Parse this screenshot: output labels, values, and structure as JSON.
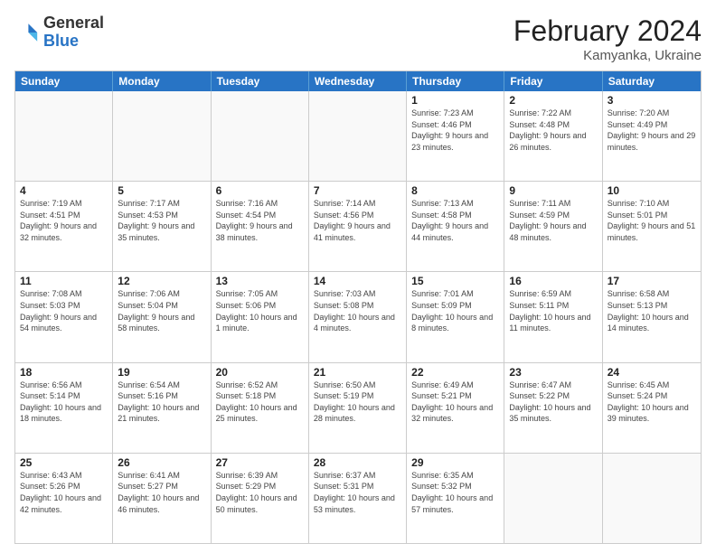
{
  "header": {
    "logo": {
      "general": "General",
      "blue": "Blue"
    },
    "title": "February 2024",
    "location": "Kamyanka, Ukraine"
  },
  "days_of_week": [
    "Sunday",
    "Monday",
    "Tuesday",
    "Wednesday",
    "Thursday",
    "Friday",
    "Saturday"
  ],
  "rows": [
    [
      {
        "day": "",
        "empty": true
      },
      {
        "day": "",
        "empty": true
      },
      {
        "day": "",
        "empty": true
      },
      {
        "day": "",
        "empty": true
      },
      {
        "day": "1",
        "sunrise": "7:23 AM",
        "sunset": "4:46 PM",
        "daylight": "9 hours and 23 minutes."
      },
      {
        "day": "2",
        "sunrise": "7:22 AM",
        "sunset": "4:48 PM",
        "daylight": "9 hours and 26 minutes."
      },
      {
        "day": "3",
        "sunrise": "7:20 AM",
        "sunset": "4:49 PM",
        "daylight": "9 hours and 29 minutes."
      }
    ],
    [
      {
        "day": "4",
        "sunrise": "7:19 AM",
        "sunset": "4:51 PM",
        "daylight": "9 hours and 32 minutes."
      },
      {
        "day": "5",
        "sunrise": "7:17 AM",
        "sunset": "4:53 PM",
        "daylight": "9 hours and 35 minutes."
      },
      {
        "day": "6",
        "sunrise": "7:16 AM",
        "sunset": "4:54 PM",
        "daylight": "9 hours and 38 minutes."
      },
      {
        "day": "7",
        "sunrise": "7:14 AM",
        "sunset": "4:56 PM",
        "daylight": "9 hours and 41 minutes."
      },
      {
        "day": "8",
        "sunrise": "7:13 AM",
        "sunset": "4:58 PM",
        "daylight": "9 hours and 44 minutes."
      },
      {
        "day": "9",
        "sunrise": "7:11 AM",
        "sunset": "4:59 PM",
        "daylight": "9 hours and 48 minutes."
      },
      {
        "day": "10",
        "sunrise": "7:10 AM",
        "sunset": "5:01 PM",
        "daylight": "9 hours and 51 minutes."
      }
    ],
    [
      {
        "day": "11",
        "sunrise": "7:08 AM",
        "sunset": "5:03 PM",
        "daylight": "9 hours and 54 minutes."
      },
      {
        "day": "12",
        "sunrise": "7:06 AM",
        "sunset": "5:04 PM",
        "daylight": "9 hours and 58 minutes."
      },
      {
        "day": "13",
        "sunrise": "7:05 AM",
        "sunset": "5:06 PM",
        "daylight": "10 hours and 1 minute."
      },
      {
        "day": "14",
        "sunrise": "7:03 AM",
        "sunset": "5:08 PM",
        "daylight": "10 hours and 4 minutes."
      },
      {
        "day": "15",
        "sunrise": "7:01 AM",
        "sunset": "5:09 PM",
        "daylight": "10 hours and 8 minutes."
      },
      {
        "day": "16",
        "sunrise": "6:59 AM",
        "sunset": "5:11 PM",
        "daylight": "10 hours and 11 minutes."
      },
      {
        "day": "17",
        "sunrise": "6:58 AM",
        "sunset": "5:13 PM",
        "daylight": "10 hours and 14 minutes."
      }
    ],
    [
      {
        "day": "18",
        "sunrise": "6:56 AM",
        "sunset": "5:14 PM",
        "daylight": "10 hours and 18 minutes."
      },
      {
        "day": "19",
        "sunrise": "6:54 AM",
        "sunset": "5:16 PM",
        "daylight": "10 hours and 21 minutes."
      },
      {
        "day": "20",
        "sunrise": "6:52 AM",
        "sunset": "5:18 PM",
        "daylight": "10 hours and 25 minutes."
      },
      {
        "day": "21",
        "sunrise": "6:50 AM",
        "sunset": "5:19 PM",
        "daylight": "10 hours and 28 minutes."
      },
      {
        "day": "22",
        "sunrise": "6:49 AM",
        "sunset": "5:21 PM",
        "daylight": "10 hours and 32 minutes."
      },
      {
        "day": "23",
        "sunrise": "6:47 AM",
        "sunset": "5:22 PM",
        "daylight": "10 hours and 35 minutes."
      },
      {
        "day": "24",
        "sunrise": "6:45 AM",
        "sunset": "5:24 PM",
        "daylight": "10 hours and 39 minutes."
      }
    ],
    [
      {
        "day": "25",
        "sunrise": "6:43 AM",
        "sunset": "5:26 PM",
        "daylight": "10 hours and 42 minutes."
      },
      {
        "day": "26",
        "sunrise": "6:41 AM",
        "sunset": "5:27 PM",
        "daylight": "10 hours and 46 minutes."
      },
      {
        "day": "27",
        "sunrise": "6:39 AM",
        "sunset": "5:29 PM",
        "daylight": "10 hours and 50 minutes."
      },
      {
        "day": "28",
        "sunrise": "6:37 AM",
        "sunset": "5:31 PM",
        "daylight": "10 hours and 53 minutes."
      },
      {
        "day": "29",
        "sunrise": "6:35 AM",
        "sunset": "5:32 PM",
        "daylight": "10 hours and 57 minutes."
      },
      {
        "day": "",
        "empty": true
      },
      {
        "day": "",
        "empty": true
      }
    ]
  ]
}
